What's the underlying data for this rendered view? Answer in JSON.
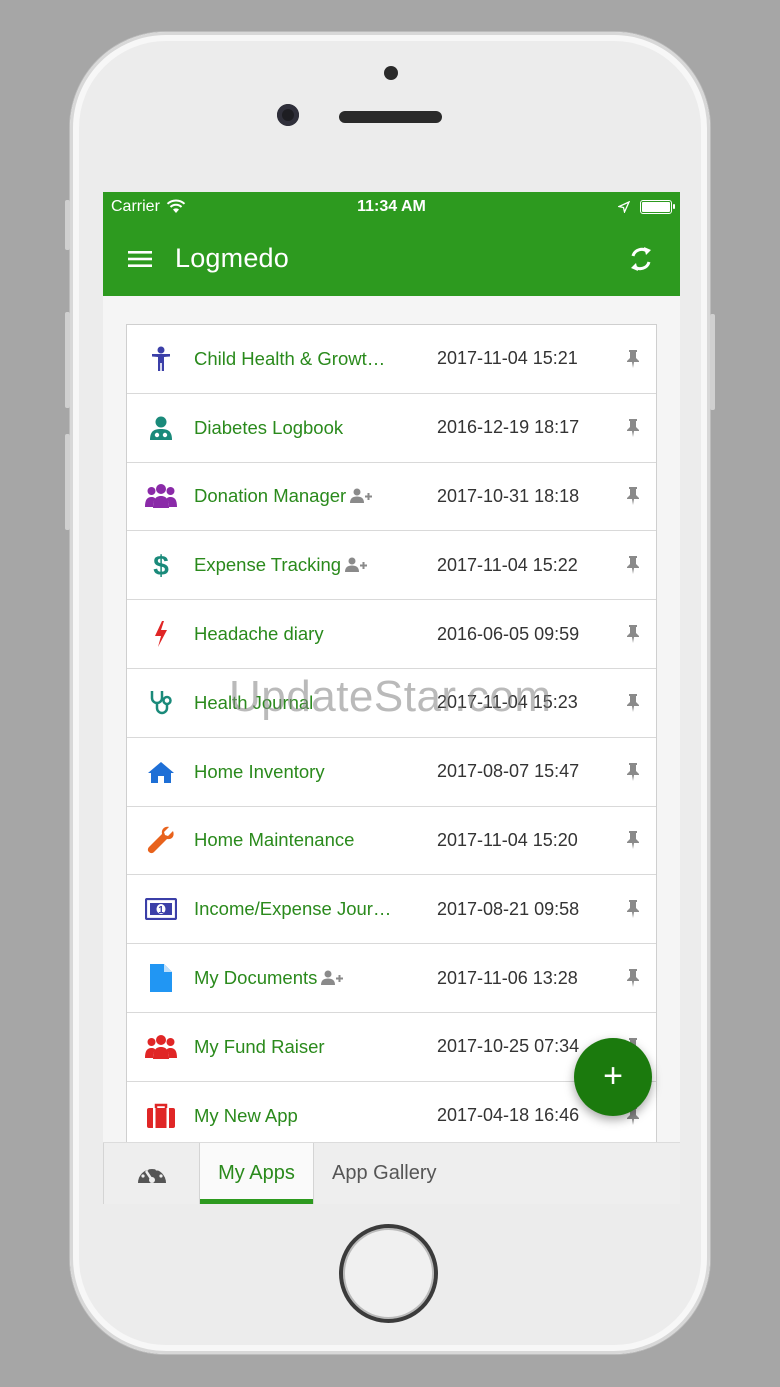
{
  "status_bar": {
    "carrier": "Carrier",
    "time": "11:34 AM"
  },
  "app_bar": {
    "title": "Logmedo"
  },
  "apps": [
    {
      "name": "Child Health & Growt…",
      "date": "2017-11-04 15:21",
      "icon": "child-icon",
      "color": "#3b3fa8",
      "shared": false
    },
    {
      "name": "Diabetes Logbook",
      "date": "2016-12-19 18:17",
      "icon": "doctor-icon",
      "color": "#1a8a7a",
      "shared": false
    },
    {
      "name": "Donation Manager",
      "date": "2017-10-31 18:18",
      "icon": "group-icon",
      "color": "#8a2aa8",
      "shared": true
    },
    {
      "name": "Expense Tracking",
      "date": "2017-11-04 15:22",
      "icon": "dollar-icon",
      "color": "#1a8a7a",
      "shared": true
    },
    {
      "name": "Headache diary",
      "date": "2016-06-05 09:59",
      "icon": "bolt-icon",
      "color": "#e02626",
      "shared": false
    },
    {
      "name": "Health Journal",
      "date": "2017-11-04 15:23",
      "icon": "stethoscope-icon",
      "color": "#1a8a7a",
      "shared": false
    },
    {
      "name": "Home Inventory",
      "date": "2017-08-07 15:47",
      "icon": "home-icon",
      "color": "#1e6fd6",
      "shared": false
    },
    {
      "name": "Home Maintenance",
      "date": "2017-11-04 15:20",
      "icon": "wrench-icon",
      "color": "#e8621c",
      "shared": false
    },
    {
      "name": "Income/Expense Jour…",
      "date": "2017-08-21 09:58",
      "icon": "money-icon",
      "color": "#3b3fa8",
      "shared": false
    },
    {
      "name": "My Documents",
      "date": "2017-11-06 13:28",
      "icon": "document-icon",
      "color": "#2196f3",
      "shared": true
    },
    {
      "name": "My Fund Raiser",
      "date": "2017-10-25 07:34",
      "icon": "group-icon",
      "color": "#e02626",
      "shared": false
    },
    {
      "name": "My New App",
      "date": "2017-04-18 16:46",
      "icon": "briefcase-icon",
      "color": "#e02626",
      "shared": false
    }
  ],
  "tabs": {
    "dashboard_icon": "dashboard-icon",
    "my_apps": "My Apps",
    "app_gallery": "App Gallery"
  },
  "fab": {
    "label": "+"
  },
  "watermark": "UpdateStar.com"
}
